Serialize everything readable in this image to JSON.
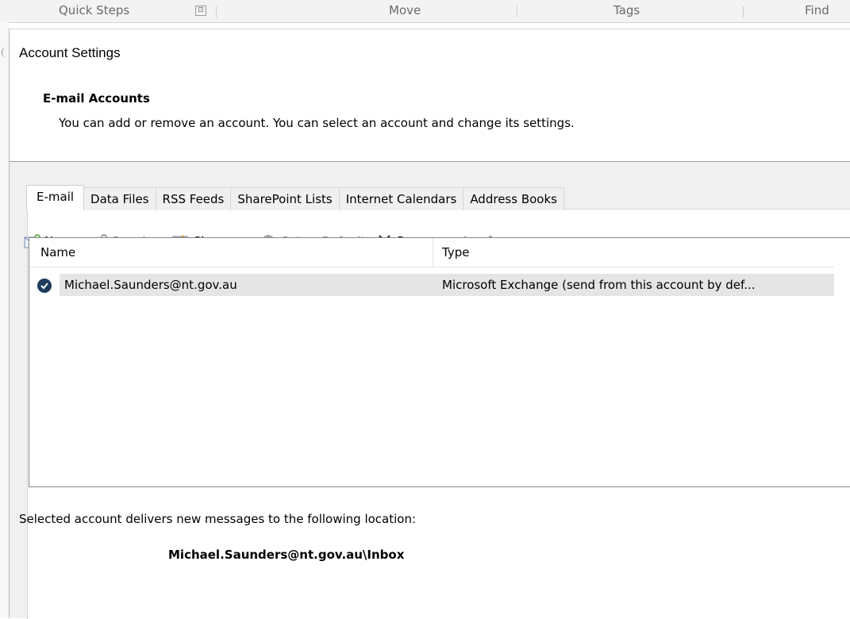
{
  "ribbon": {
    "groups": [
      "Quick Steps",
      "Move",
      "Tags",
      "Find"
    ],
    "launcher": "⊡"
  },
  "dialog": {
    "title": "Account Settings",
    "section_title": "E-mail Accounts",
    "section_desc": "You can add or remove an account. You can select an account and change its settings."
  },
  "tabs": [
    "E-mail",
    "Data Files",
    "RSS Feeds",
    "SharePoint Lists",
    "Internet Calendars",
    "Address Books"
  ],
  "toolbar": {
    "new": "New...",
    "repair": "Repair...",
    "change": "Change...",
    "set_default": "Set as Default",
    "remove": "Remove"
  },
  "list": {
    "headers": [
      "Name",
      "Type"
    ],
    "rows": [
      {
        "name": "Michael.Saunders@nt.gov.au",
        "type": "Microsoft Exchange (send from this account by def..."
      }
    ]
  },
  "delivery": {
    "text": "Selected account delivers new messages to the following location:",
    "location": "Michael.Saunders@nt.gov.au\\Inbox"
  },
  "colors": {
    "selected_row": "#e5e5e5",
    "default_badge": "#1f3c5c"
  }
}
